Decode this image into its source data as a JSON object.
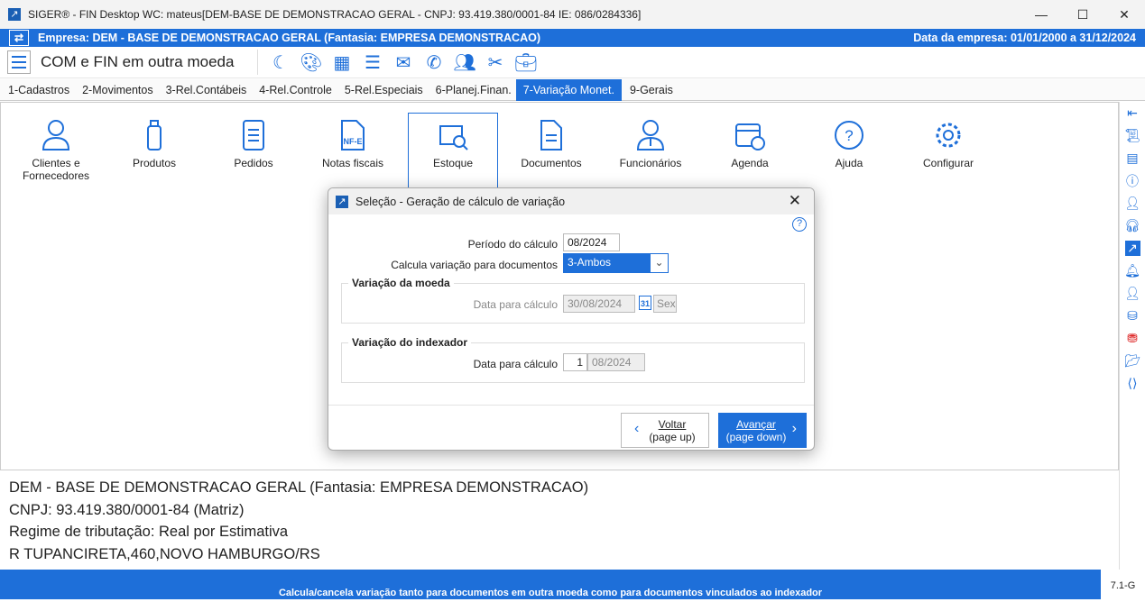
{
  "window": {
    "title": "SIGER® - FIN Desktop WC: mateus[DEM-BASE DE DEMONSTRACAO GERAL - CNPJ: 93.419.380/0001-84 IE: 086/0284336]"
  },
  "company_bar": {
    "company": "Empresa: DEM - BASE DE DEMONSTRACAO GERAL (Fantasia: EMPRESA DEMONSTRACAO)",
    "date_range": "Data da empresa: 01/01/2000 a 31/12/2024"
  },
  "toolbar": {
    "title": "COM e FIN em outra moeda"
  },
  "menu": [
    "1-Cadastros",
    "2-Movimentos",
    "3-Rel.Contábeis",
    "4-Rel.Controle",
    "5-Rel.Especiais",
    "6-Planej.Finan.",
    "7-Variação Monet.",
    "9-Gerais"
  ],
  "shortcuts": [
    "Clientes e Fornecedores",
    "Produtos",
    "Pedidos",
    "Notas fiscais",
    "Estoque",
    "Documentos",
    "Funcionários",
    "Agenda",
    "Ajuda",
    "Configurar"
  ],
  "nfe_label": "NF-E",
  "info": [
    "DEM - BASE DE DEMONSTRACAO GERAL (Fantasia: EMPRESA DEMONSTRACAO)",
    "CNPJ: 93.419.380/0001-84 (Matriz)",
    "Regime de tributação: Real por Estimativa",
    "R TUPANCIRETA,460,NOVO HAMBURGO/RS"
  ],
  "status": "Calcula/cancela variação tanto para documentos em outra moeda como para documentos vinculados ao indexador",
  "version": "7.1-G",
  "dialog": {
    "title": "Seleção - Geração de cálculo de variação",
    "periodo_label": "Período do cálculo",
    "periodo_value": "08/2024",
    "calcula_label": "Calcula variação para documentos",
    "calcula_value": "3-Ambos",
    "moeda_legend": "Variação da moeda",
    "moeda_data_label": "Data para cálculo",
    "moeda_data_value": "30/08/2024",
    "moeda_weekday": "Sex",
    "calendar_day": "31",
    "indexador_legend": "Variação do indexador",
    "indexador_data_label": "Data para cálculo",
    "indexador_day": "1",
    "indexador_month": "08/2024",
    "back_label": "Voltar",
    "back_hint": "(page up)",
    "next_label": "Avançar",
    "next_hint": "(page down)"
  }
}
